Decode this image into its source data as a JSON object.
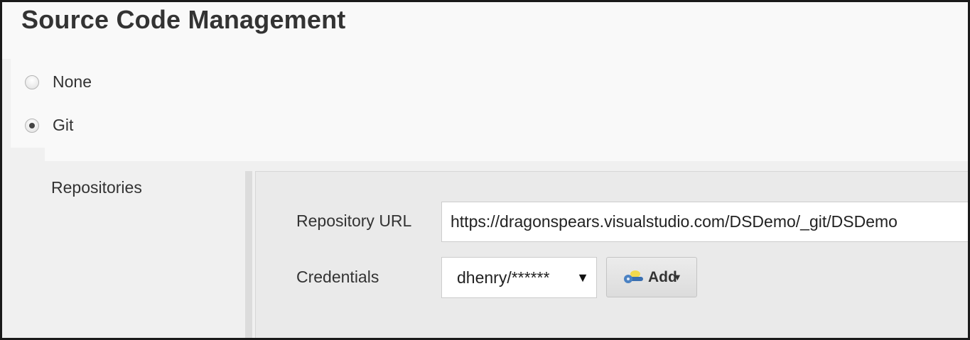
{
  "section": {
    "title": "Source Code Management"
  },
  "scm_options": [
    {
      "label": "None",
      "selected": false
    },
    {
      "label": "Git",
      "selected": true
    }
  ],
  "git": {
    "repositories_label": "Repositories",
    "repository_url": {
      "label": "Repository URL",
      "value": "https://dragonspears.visualstudio.com/DSDemo/_git/DSDemo"
    },
    "credentials": {
      "label": "Credentials",
      "selected": "dhenry/******"
    },
    "add_button": {
      "label": "Add",
      "icon": "key-icon"
    }
  }
}
